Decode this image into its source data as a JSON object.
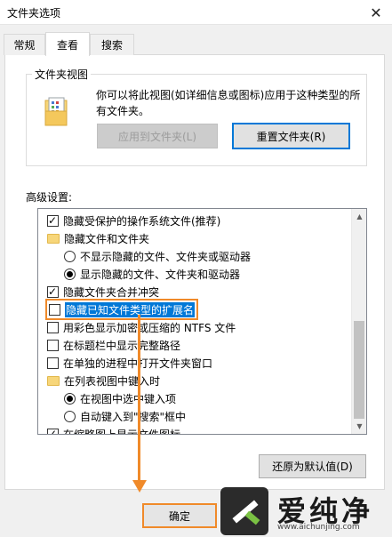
{
  "window": {
    "title": "文件夹选项",
    "close_icon": "✕"
  },
  "tabs": [
    {
      "label": "常规",
      "active": false
    },
    {
      "label": "查看",
      "active": true
    },
    {
      "label": "搜索",
      "active": false
    }
  ],
  "folder_views": {
    "legend": "文件夹视图",
    "description": "你可以将此视图(如详细信息或图标)应用于这种类型的所有文件夹。",
    "apply_button": "应用到文件夹(L)",
    "reset_button": "重置文件夹(R)"
  },
  "advanced": {
    "label": "高级设置:",
    "items": [
      {
        "kind": "checkbox",
        "checked": true,
        "indent": 0,
        "label": "隐藏受保护的操作系统文件(推荐)"
      },
      {
        "kind": "folder",
        "indent": 0,
        "label": "隐藏文件和文件夹"
      },
      {
        "kind": "radio",
        "checked": false,
        "indent": 1,
        "label": "不显示隐藏的文件、文件夹或驱动器"
      },
      {
        "kind": "radio",
        "checked": true,
        "indent": 1,
        "label": "显示隐藏的文件、文件夹和驱动器"
      },
      {
        "kind": "checkbox",
        "checked": true,
        "indent": 0,
        "label": "隐藏文件夹合并冲突"
      },
      {
        "kind": "checkbox",
        "checked": false,
        "indent": 0,
        "label": "隐藏已知文件类型的扩展名",
        "highlighted": true
      },
      {
        "kind": "checkbox",
        "checked": false,
        "indent": 0,
        "label": "用彩色显示加密或压缩的 NTFS 文件"
      },
      {
        "kind": "checkbox",
        "checked": false,
        "indent": 0,
        "label": "在标题栏中显示完整路径"
      },
      {
        "kind": "checkbox",
        "checked": false,
        "indent": 0,
        "label": "在单独的进程中打开文件夹窗口"
      },
      {
        "kind": "folder",
        "indent": 0,
        "label": "在列表视图中键入时"
      },
      {
        "kind": "radio",
        "checked": true,
        "indent": 1,
        "label": "在视图中选中键入项"
      },
      {
        "kind": "radio",
        "checked": false,
        "indent": 1,
        "label": "自动键入到\"搜索\"框中"
      },
      {
        "kind": "checkbox",
        "checked": true,
        "indent": 0,
        "label": "在缩略图上显示文件图标"
      }
    ],
    "restore_button": "还原为默认值(D)"
  },
  "footer": {
    "ok_button": "确定"
  },
  "watermark": {
    "brand": "爱纯净",
    "url": "www.aichunjing.com"
  },
  "colors": {
    "highlight": "#f08a2a",
    "selection": "#0078d7"
  }
}
